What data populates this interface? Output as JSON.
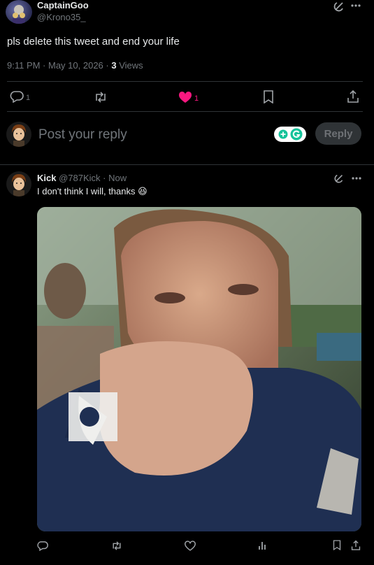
{
  "main_post": {
    "display_name": "CaptainGoo",
    "handle": "@Krono35_",
    "text": "pls delete this tweet and end your life",
    "time": "9:11 PM · May 10, 2026 · ",
    "views_count": "3",
    "views_label": " Views",
    "actions": {
      "replies": "1",
      "retweets": "",
      "likes": "1"
    }
  },
  "composer": {
    "placeholder": "Post your reply",
    "reply_label": "Reply"
  },
  "reply_post": {
    "display_name": "Kick",
    "handle": "@787Kick",
    "time": " · Now",
    "text": "I don't think I will, thanks",
    "emoji": "😆"
  },
  "colors": {
    "like": "#f91880",
    "reply_button_bg": "#2f3336",
    "grammarly": "#15c39a"
  }
}
